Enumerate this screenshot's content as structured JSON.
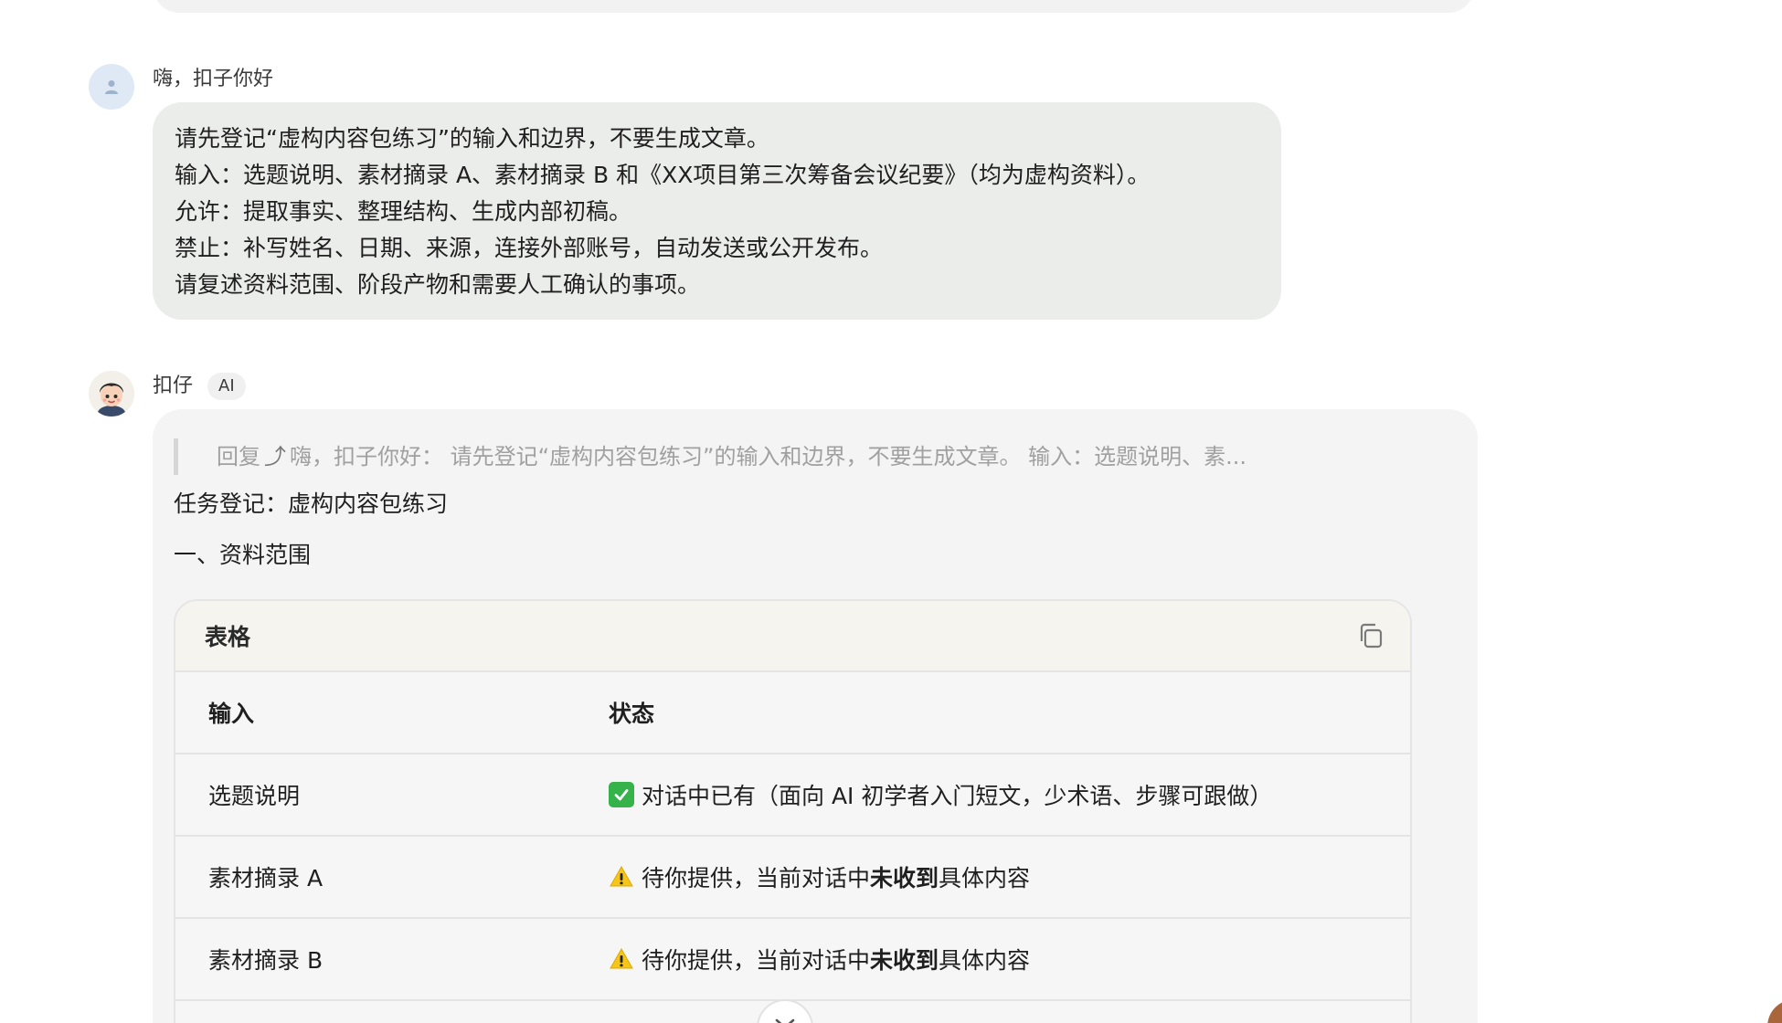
{
  "user_message": {
    "sender": "嗨，扣子你好",
    "lines": [
      "请先登记“虚构内容包练习”的输入和边界，不要生成文章。",
      "输入：选题说明、素材摘录 A、素材摘录 B 和《XX项目第三次筹备会议纪要》（均为虚构资料）。",
      "允许：提取事实、整理结构、生成内部初稿。",
      "禁止：补写姓名、日期、来源，连接外部账号，自动发送或公开发布。",
      "请复述资料范围、阶段产物和需要人工确认的事项。"
    ]
  },
  "ai_message": {
    "sender": "扣仔",
    "badge": "AI",
    "quote_prefix": "回复",
    "quote_text": "嗨，扣子你好：  请先登记“虚构内容包练习”的输入和边界，不要生成文章。 输入：选题说明、素...",
    "task_line": "任务登记：虚构内容包练习",
    "section_line": "一、资料范围",
    "table": {
      "title": "表格",
      "headers": [
        "输入",
        "状态"
      ],
      "rows": [
        {
          "input": "选题说明",
          "status_icon": "check-icon",
          "status_before": "对话中已有（面向 AI 初学者入门短文，少术语、步骤可跟做）",
          "status_bold": "",
          "status_after": ""
        },
        {
          "input": "素材摘录 A",
          "status_icon": "warning-icon",
          "status_before": "待你提供，当前对话中",
          "status_bold": "未收到",
          "status_after": "具体内容"
        },
        {
          "input": "素材摘录 B",
          "status_icon": "warning-icon",
          "status_before": "待你提供，当前对话中",
          "status_bold": "未收到",
          "status_after": "具体内容"
        }
      ]
    }
  },
  "colors": {
    "user_bubble": "#ebedea",
    "ai_bubble": "#f4f4f4",
    "check_green": "#35b34a",
    "warning_yellow": "#f5c518"
  }
}
